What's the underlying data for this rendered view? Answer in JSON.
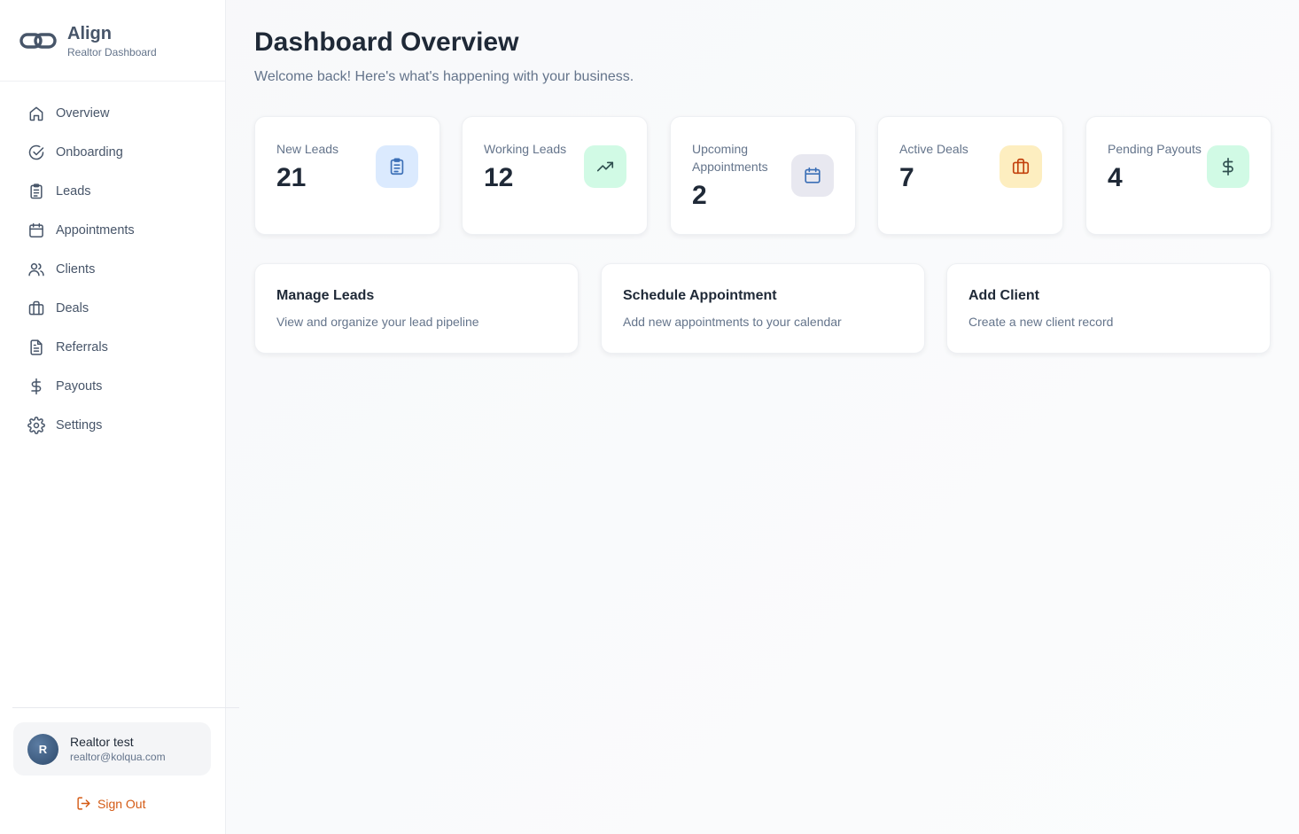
{
  "brand": {
    "name": "Align",
    "subtitle": "Realtor Dashboard"
  },
  "nav": [
    {
      "label": "Overview",
      "icon": "home-icon"
    },
    {
      "label": "Onboarding",
      "icon": "check-circle-icon"
    },
    {
      "label": "Leads",
      "icon": "clipboard-icon"
    },
    {
      "label": "Appointments",
      "icon": "calendar-icon"
    },
    {
      "label": "Clients",
      "icon": "users-icon"
    },
    {
      "label": "Deals",
      "icon": "briefcase-icon"
    },
    {
      "label": "Referrals",
      "icon": "file-text-icon"
    },
    {
      "label": "Payouts",
      "icon": "dollar-icon"
    },
    {
      "label": "Settings",
      "icon": "gear-icon"
    }
  ],
  "user": {
    "initial": "R",
    "name": "Realtor test",
    "email": "realtor@kolqua.com"
  },
  "signout_label": "Sign Out",
  "header": {
    "title": "Dashboard Overview",
    "subtitle": "Welcome back! Here's what's happening with your business."
  },
  "stats": [
    {
      "label": "New Leads",
      "value": "21",
      "icon": "clipboard-icon",
      "icon_bg": "#dbeafe",
      "icon_color": "#3b6fb6"
    },
    {
      "label": "Working Leads",
      "value": "12",
      "icon": "trending-up-icon",
      "icon_bg": "#d1fae5",
      "icon_color": "#2f4f4f"
    },
    {
      "label": "Upcoming Appointments",
      "value": "2",
      "icon": "calendar-icon",
      "icon_bg": "#e8e8f0",
      "icon_color": "#3b6fb6"
    },
    {
      "label": "Active Deals",
      "value": "7",
      "icon": "briefcase-icon",
      "icon_bg": "#fdeec0",
      "icon_color": "#c2410c"
    },
    {
      "label": "Pending Payouts",
      "value": "4",
      "icon": "dollar-icon",
      "icon_bg": "#d1fae5",
      "icon_color": "#2f4f4f"
    }
  ],
  "actions": [
    {
      "title": "Manage Leads",
      "description": "View and organize your lead pipeline"
    },
    {
      "title": "Schedule Appointment",
      "description": "Add new appointments to your calendar"
    },
    {
      "title": "Add Client",
      "description": "Create a new client record"
    }
  ],
  "colors": {
    "accent": "#d45a14",
    "text": "#1f2937",
    "muted": "#64748b"
  }
}
